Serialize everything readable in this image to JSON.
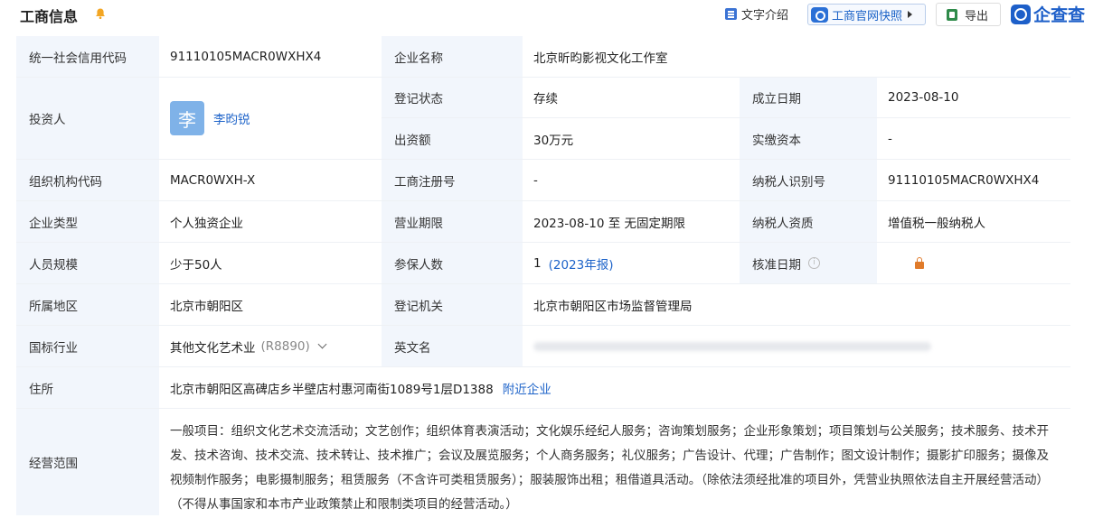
{
  "header": {
    "title": "工商信息",
    "text_intro": "文字介绍",
    "snapshot": "工商官网快照",
    "export": "导出",
    "brand": "企查查"
  },
  "fields": {
    "credit_code_label": "统一社会信用代码",
    "credit_code": "91110105MACR0WXHX4",
    "company_name_label": "企业名称",
    "company_name": "北京昕昀影视文化工作室",
    "investor_label": "投资人",
    "investor_avatar": "李",
    "investor_name": "李昀锐",
    "reg_status_label": "登记状态",
    "reg_status": "存续",
    "founded_label": "成立日期",
    "founded": "2023-08-10",
    "capital_label": "出资额",
    "capital": "30万元",
    "paid_capital_label": "实缴资本",
    "paid_capital": "-",
    "org_code_label": "组织机构代码",
    "org_code": "MACR0WXH-X",
    "reg_no_label": "工商注册号",
    "reg_no": "-",
    "taxpayer_id_label": "纳税人识别号",
    "taxpayer_id": "91110105MACR0WXHX4",
    "company_type_label": "企业类型",
    "company_type": "个人独资企业",
    "term_label": "营业期限",
    "term": "2023-08-10 至 无固定期限",
    "taxpayer_qual_label": "纳税人资质",
    "taxpayer_qual": "增值税一般纳税人",
    "staff_label": "人员规模",
    "staff": "少于50人",
    "insured_label": "参保人数",
    "insured": "1",
    "insured_year": "(2023年报)",
    "approval_label": "核准日期",
    "region_label": "所属地区",
    "region": "北京市朝阳区",
    "authority_label": "登记机关",
    "authority": "北京市朝阳区市场监督管理局",
    "industry_label": "国标行业",
    "industry": "其他文化艺术业",
    "industry_code": "(R8890)",
    "english_name_label": "英文名",
    "address_label": "住所",
    "address": "北京市朝阳区高碑店乡半壁店村惠河南街1089号1层D1388",
    "nearby": "附近企业",
    "scope_label": "经营范围",
    "scope": "一般项目：组织文化艺术交流活动；文艺创作；组织体育表演活动；文化娱乐经纪人服务；咨询策划服务；企业形象策划；项目策划与公关服务；技术服务、技术开发、技术咨询、技术交流、技术转让、技术推广；会议及展览服务；个人商务服务；礼仪服务；广告设计、代理；广告制作；图文设计制作；摄影扩印服务；摄像及视频制作服务；电影摄制服务；租赁服务（不含许可类租赁服务）；服装服饰出租；租借道具活动。（除依法须经批准的项目外，凭营业执照依法自主开展经营活动）（不得从事国家和本市产业政策禁止和限制类项目的经营活动。）"
  },
  "colors": {
    "label_bg": "#f2f6fc",
    "link": "#1d63c9",
    "brand": "#1d5fc9"
  }
}
